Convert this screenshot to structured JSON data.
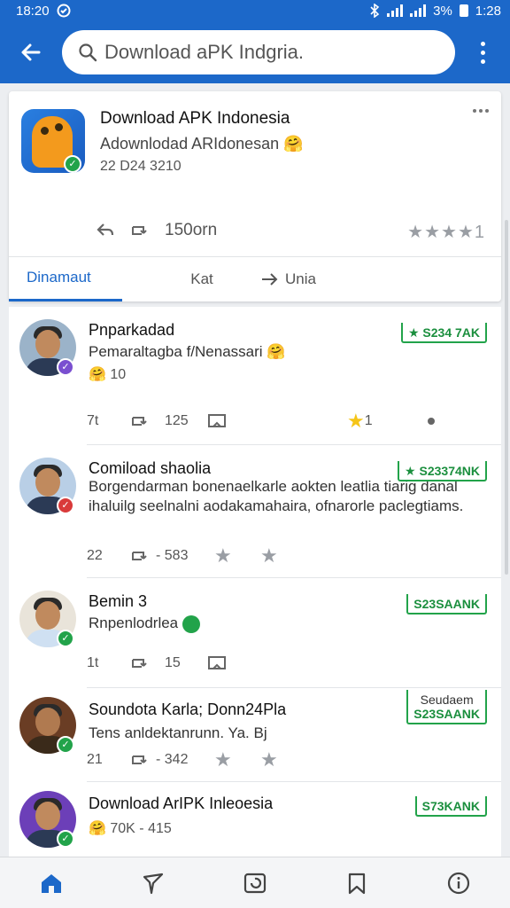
{
  "status": {
    "time_left": "18:20",
    "battery": "3%",
    "time_right": "1:28"
  },
  "appbar": {
    "search_value": "",
    "search_placeholder": "Download aPK Indgria."
  },
  "header": {
    "title": "Download APK Indonesia",
    "subtitle": "Adownlodad ARIdonesan",
    "date": "22  D24 3210",
    "share_count": "150orn",
    "rating_stars": 4,
    "rating_value": "1"
  },
  "tabs": [
    {
      "label": "Dinamaut",
      "active": true
    },
    {
      "label": "Kat",
      "active": false
    },
    {
      "label": "Unia",
      "active": false
    }
  ],
  "posts": [
    {
      "name": "Pnparkadad",
      "text": "Pemaraltagba f/Nenassari",
      "meta": "10",
      "actions": [
        "7t",
        "125"
      ],
      "star_count": "1",
      "badge": "S234 7AK",
      "badge_note": "",
      "avatar_bg": "#9bb3c9",
      "verify_color": "#7a4fd0"
    },
    {
      "name": "Comiload shaolia",
      "text": "Borgendarman bonenaelkarle aokten leatlia tiarig danal ihaluilg seelnalni aodakamahaira, ofnarorle paclegtiams.",
      "meta": "",
      "actions": [
        "22",
        "- 583"
      ],
      "star_count": "",
      "badge": "S23374NK",
      "badge_note": "",
      "avatar_bg": "#b9cfe6",
      "verify_color": "#d93a3a"
    },
    {
      "name": "Bemin 3",
      "text": "Rnpenlodrlea",
      "meta": "",
      "actions": [
        "1t",
        "15"
      ],
      "star_count": "",
      "badge": "S23SAANK",
      "badge_note": "",
      "avatar_bg": "#e9e4da",
      "verify_color": "#22a34a"
    },
    {
      "name": "Soundota Karla; Donn24Pla",
      "text": "Tens anldektanrunn. Ya. Bj",
      "meta": "",
      "actions": [
        "21",
        "- 342"
      ],
      "star_count": "",
      "badge": "S23SAANK",
      "badge_note": "Seudaem",
      "avatar_bg": "#6a3d24",
      "verify_color": "#22a34a"
    },
    {
      "name": "Download ArIPK Inleoesia",
      "text": "",
      "meta": "70K - 415",
      "actions": [],
      "star_count": "",
      "badge": "S73KANK",
      "badge_note": "",
      "avatar_bg": "#6c3fb8",
      "verify_color": "#22a34a"
    }
  ],
  "nav": [
    "home-icon",
    "explore-icon",
    "library-icon",
    "bookmark-icon",
    "info-icon"
  ],
  "colors": {
    "primary": "#1c68c9",
    "accent_green": "#22a34a",
    "star_gold": "#f5c518"
  }
}
